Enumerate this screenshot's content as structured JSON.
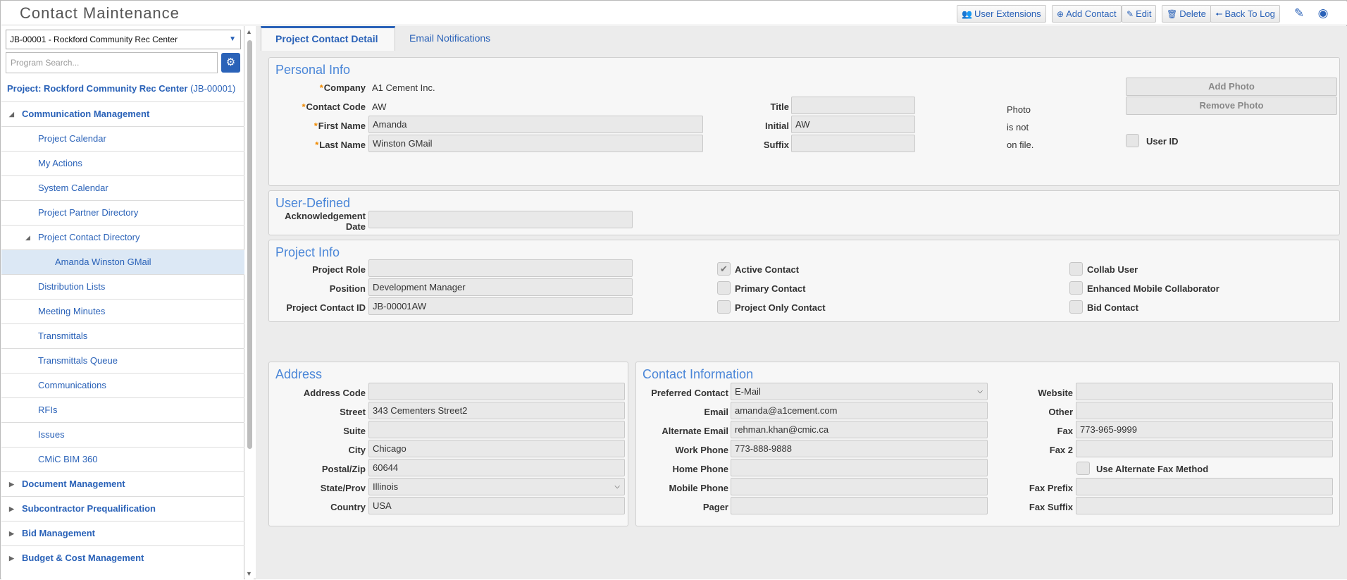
{
  "header": {
    "app_title": "Contact Maintenance",
    "buttons": {
      "user_extensions": "User Extensions",
      "add_contact": "Add Contact",
      "edit": "Edit",
      "delete": "Delete",
      "back_to_log": "Back To Log"
    }
  },
  "sidebar": {
    "project_selected": "JB-00001 - Rockford Community Rec Center",
    "search_placeholder": "Program Search...",
    "project_title_prefix": "Project: Rockford Community Rec Center",
    "project_title_code": "(JB-00001)",
    "nav": [
      {
        "label": "Communication Management"
      },
      {
        "label": "Project Calendar"
      },
      {
        "label": "My Actions"
      },
      {
        "label": "System Calendar"
      },
      {
        "label": "Project Partner Directory"
      },
      {
        "label": "Project Contact Directory"
      },
      {
        "label": "Amanda Winston GMail"
      },
      {
        "label": "Distribution Lists"
      },
      {
        "label": "Meeting Minutes"
      },
      {
        "label": "Transmittals"
      },
      {
        "label": "Transmittals Queue"
      },
      {
        "label": "Communications"
      },
      {
        "label": "RFIs"
      },
      {
        "label": "Issues"
      },
      {
        "label": "CMiC BIM 360"
      },
      {
        "label": "Document Management"
      },
      {
        "label": "Subcontractor Prequalification"
      },
      {
        "label": "Bid Management"
      },
      {
        "label": "Budget & Cost Management"
      }
    ]
  },
  "tabs": [
    "Project Contact Detail",
    "Email Notifications"
  ],
  "personal_info": {
    "title": "Personal Info",
    "company_label": "Company",
    "company_value": "A1 Cement Inc.",
    "contact_code_label": "Contact Code",
    "contact_code_value": "AW",
    "first_name_label": "First Name",
    "first_name_value": "Amanda",
    "last_name_label": "Last Name",
    "last_name_value": "Winston GMail",
    "title_label": "Title",
    "title_value": "",
    "initial_label": "Initial",
    "initial_value": "AW",
    "suffix_label": "Suffix",
    "suffix_value": "",
    "photo_line1": "Photo",
    "photo_line2": "is not",
    "photo_line3": "on file.",
    "add_photo": "Add Photo",
    "remove_photo": "Remove Photo",
    "user_id_label": "User ID"
  },
  "user_defined": {
    "title": "User-Defined",
    "ack_label_1": "Acknowledgement",
    "ack_label_2": "Date",
    "ack_value": ""
  },
  "project_info": {
    "title": "Project Info",
    "role_label": "Project Role",
    "role_value": "",
    "position_label": "Position",
    "position_value": "Development Manager",
    "contact_id_label": "Project Contact ID",
    "contact_id_value": "JB-00001AW",
    "active_contact": "Active Contact",
    "primary_contact": "Primary Contact",
    "project_only_contact": "Project Only Contact",
    "collab_user": "Collab User",
    "enhanced_mobile": "Enhanced Mobile Collaborator",
    "bid_contact": "Bid Contact",
    "active_checked": true
  },
  "address": {
    "title": "Address",
    "address_code_label": "Address Code",
    "address_code_value": "",
    "street_label": "Street",
    "street_value": "343 Cementers Street2",
    "suite_label": "Suite",
    "suite_value": "",
    "city_label": "City",
    "city_value": "Chicago",
    "postal_label": "Postal/Zip",
    "postal_value": "60644",
    "state_label": "State/Prov",
    "state_value": "Illinois",
    "country_label": "Country",
    "country_value": "USA"
  },
  "contact_info": {
    "title": "Contact Information",
    "preferred_label": "Preferred Contact",
    "preferred_value": "E-Mail",
    "email_label": "Email",
    "email_value": "amanda@a1cement.com",
    "alt_email_label": "Alternate Email",
    "alt_email_value": "rehman.khan@cmic.ca",
    "work_phone_label": "Work Phone",
    "work_phone_value": "773-888-9888",
    "home_phone_label": "Home Phone",
    "home_phone_value": "",
    "mobile_phone_label": "Mobile Phone",
    "mobile_phone_value": "",
    "pager_label": "Pager",
    "pager_value": "",
    "website_label": "Website",
    "website_value": "",
    "other_label": "Other",
    "other_value": "",
    "fax_label": "Fax",
    "fax_value": "773-965-9999",
    "fax2_label": "Fax 2",
    "fax2_value": "",
    "alt_fax_label": "Use Alternate Fax Method",
    "fax_prefix_label": "Fax Prefix",
    "fax_prefix_value": "",
    "fax_suffix_label": "Fax Suffix",
    "fax_suffix_value": ""
  }
}
